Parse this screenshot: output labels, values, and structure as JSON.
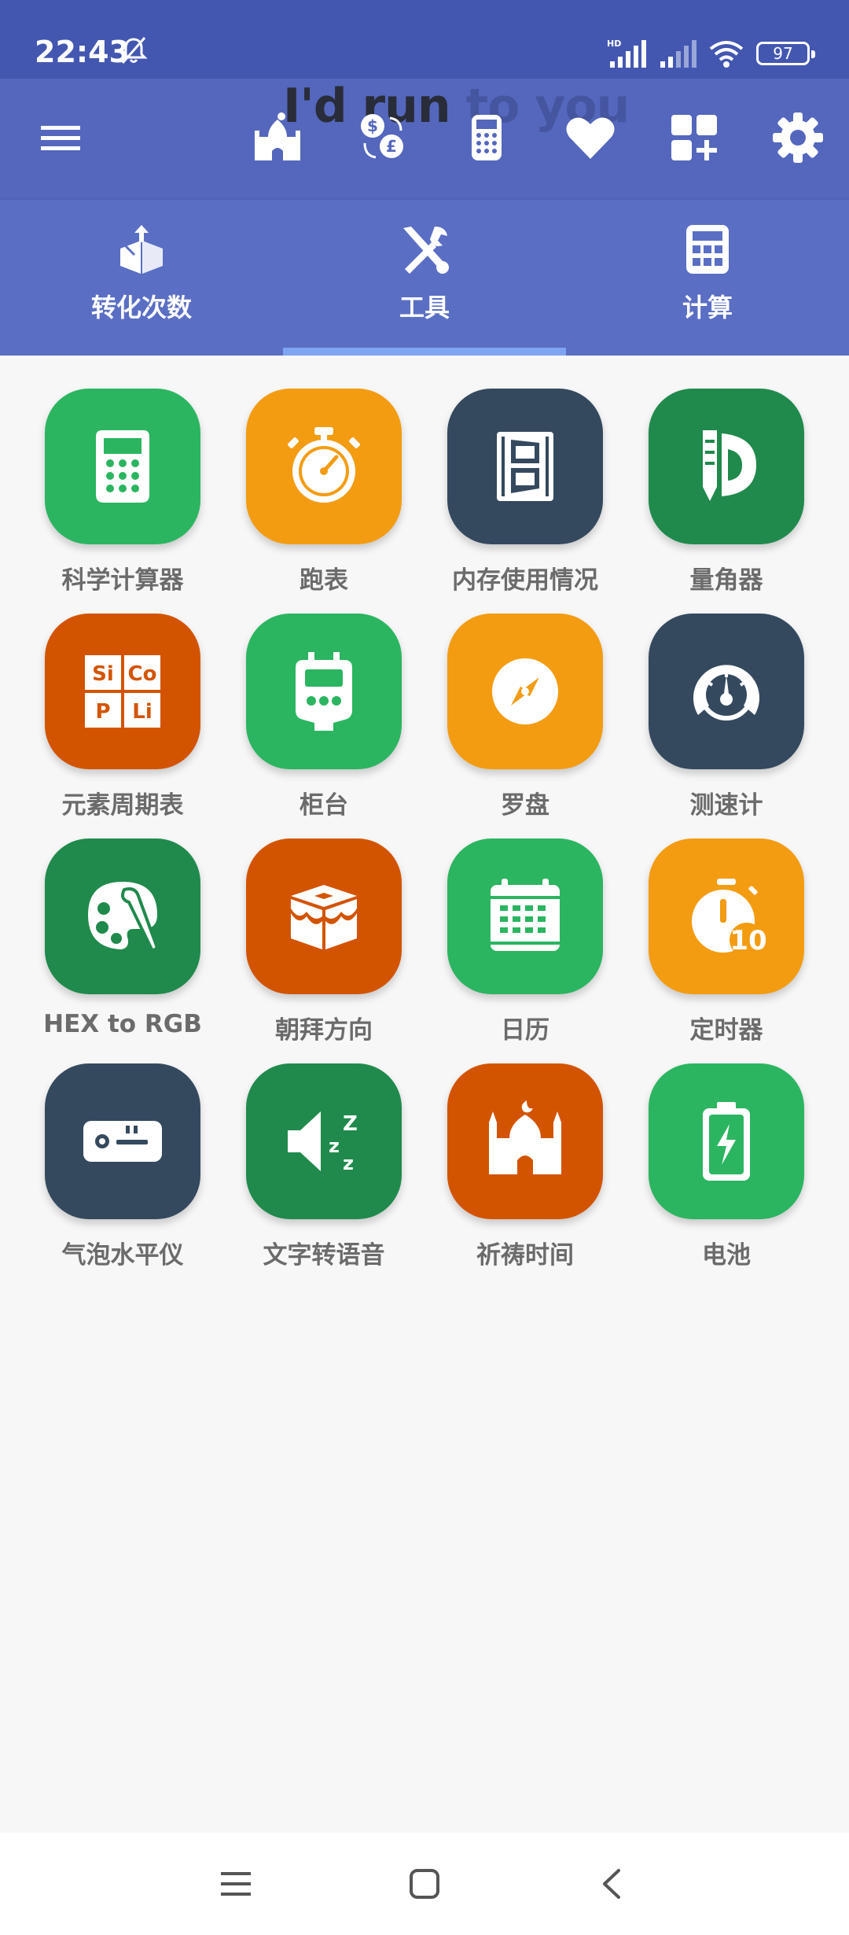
{
  "status_bar": {
    "time": "22:43",
    "network_label": "HD",
    "battery": "97"
  },
  "toolbar": {
    "overlay_text_dark": "I'd run",
    "overlay_text_light": " to you",
    "icons": [
      "menu-icon",
      "mosque-icon",
      "currency-exchange-icon",
      "calculator-icon",
      "heart-icon",
      "add-widget-icon",
      "settings-icon"
    ]
  },
  "tabs": [
    {
      "label": "转化次数",
      "icon": "conversion-icon",
      "selected": false
    },
    {
      "label": "工具",
      "icon": "tools-icon",
      "selected": true
    },
    {
      "label": "计算",
      "icon": "calculator-icon",
      "selected": false
    }
  ],
  "tools": [
    {
      "label": "科学计算器",
      "icon": "scientific-calculator-icon",
      "color": "#2bb560"
    },
    {
      "label": "跑表",
      "icon": "stopwatch-icon",
      "color": "#f39c12"
    },
    {
      "label": "内存使用情况",
      "icon": "memory-icon",
      "color": "#34495e"
    },
    {
      "label": "量角器",
      "icon": "protractor-icon",
      "color": "#1f8a4c"
    },
    {
      "label": "元素周期表",
      "icon": "periodic-table-icon",
      "color": "#d35400"
    },
    {
      "label": "柜台",
      "icon": "counter-icon",
      "color": "#2bb560"
    },
    {
      "label": "罗盘",
      "icon": "compass-icon",
      "color": "#f39c12"
    },
    {
      "label": "测速计",
      "icon": "speedometer-icon",
      "color": "#34495e"
    },
    {
      "label": "HEX to RGB",
      "icon": "palette-icon",
      "color": "#1f8a4c"
    },
    {
      "label": "朝拜方向",
      "icon": "kaaba-icon",
      "color": "#d35400"
    },
    {
      "label": "日历",
      "icon": "calendar-icon",
      "color": "#2bb560"
    },
    {
      "label": "定时器",
      "icon": "timer-icon",
      "color": "#f39c12"
    },
    {
      "label": "气泡水平仪",
      "icon": "bubble-level-icon",
      "color": "#34495e"
    },
    {
      "label": "文字转语音",
      "icon": "text-to-speech-icon",
      "color": "#1f8a4c"
    },
    {
      "label": "祈祷时间",
      "icon": "prayer-time-icon",
      "color": "#d35400"
    },
    {
      "label": "电池",
      "icon": "battery-icon",
      "color": "#2bb560"
    }
  ],
  "timer_badge": "10",
  "periodic_cells": [
    "Si",
    "Co",
    "P",
    "Li"
  ],
  "nav_bar": [
    "recent-apps-icon",
    "home-icon",
    "back-icon"
  ]
}
